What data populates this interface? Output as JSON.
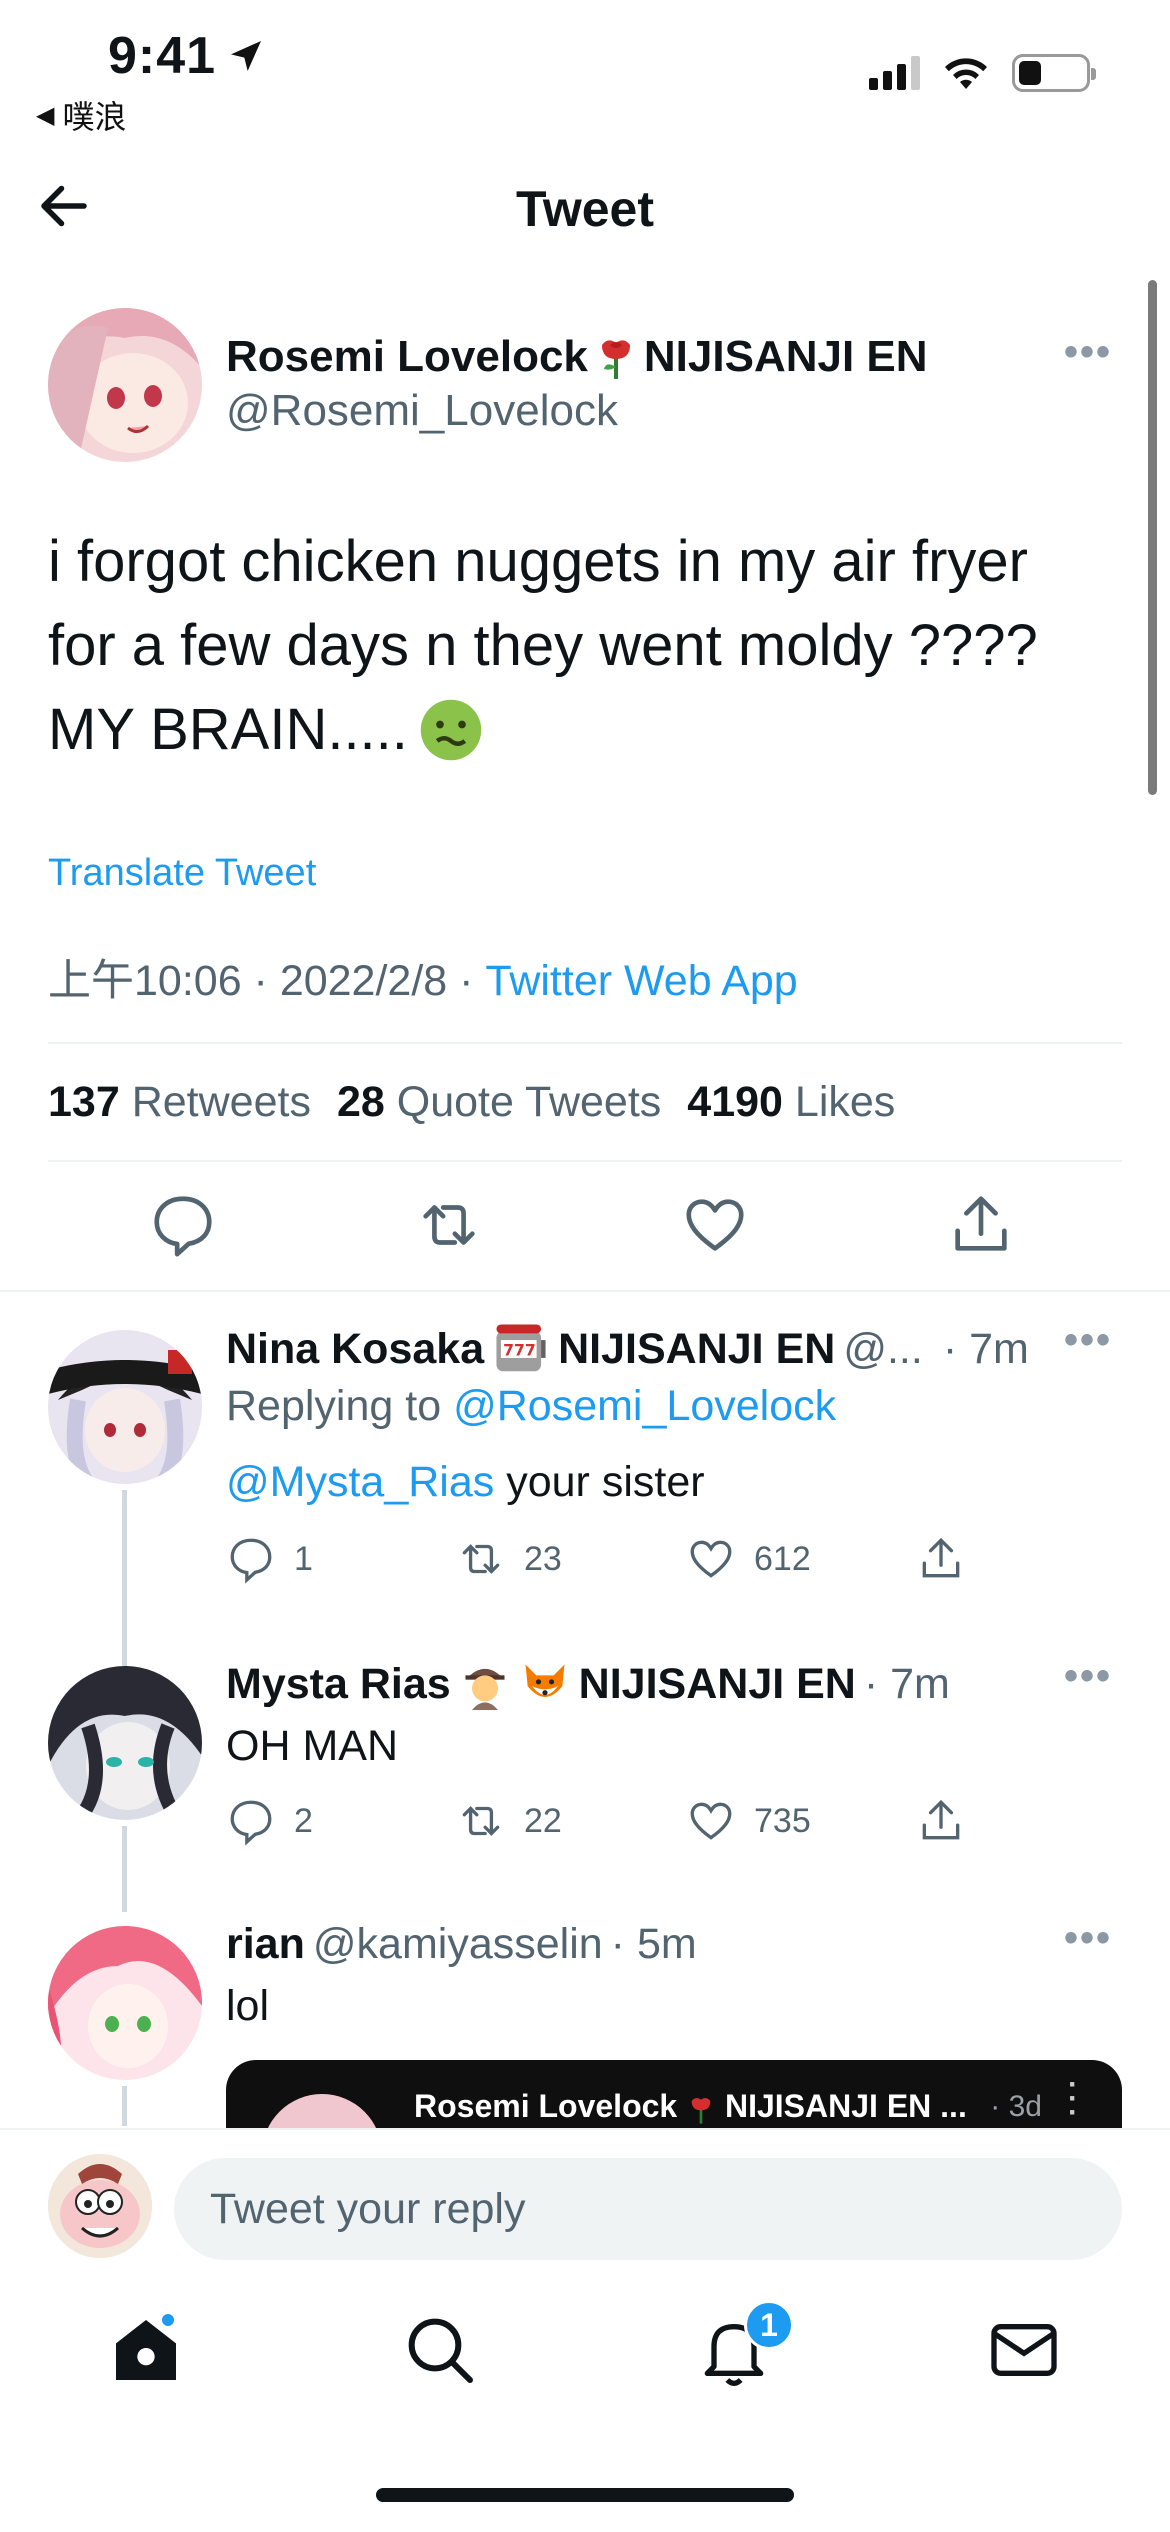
{
  "status_bar": {
    "time": "9:41",
    "back_app": "噗浪"
  },
  "header": {
    "title": "Tweet"
  },
  "main_tweet": {
    "name": "Rosemi Lovelock",
    "name_suffix": "NIJISANJI EN",
    "handle": "@Rosemi_Lovelock",
    "text_line1": "i forgot chicken nuggets in my air fryer",
    "text_line2": "for a few days n they went moldy ????",
    "text_line3": "MY BRAIN.....",
    "translate": "Translate Tweet",
    "time": "上午10:06 · 2022/2/8 · ",
    "app": "Twitter Web App",
    "retweets_count": "137",
    "retweets_label": "Retweets",
    "quotes_count": "28",
    "quotes_label": "Quote Tweets",
    "likes_count": "4190",
    "likes_label": "Likes"
  },
  "replies": [
    {
      "name": "Nina Kosaka",
      "name_suffix": "NIJISANJI EN",
      "handle": "@...",
      "time": "· 7m",
      "replying_prefix": "Replying to ",
      "replying_to": "@Rosemi_Lovelock",
      "mention": "@Mysta_Rias",
      "text": " your sister",
      "replies": "1",
      "retweets": "23",
      "likes": "612"
    },
    {
      "name": "Mysta Rias",
      "name_suffix": "NIJISANJI EN",
      "time": "· 7m",
      "text": "OH MAN",
      "replies": "2",
      "retweets": "22",
      "likes": "735"
    },
    {
      "name": "rian",
      "handle": "@kamiyasselin",
      "time": "· 5m",
      "text": "lol",
      "quote_name": "Rosemi Lovelock",
      "quote_suffix": "NIJISANJI EN ...",
      "quote_time": "· 3d"
    }
  ],
  "reply_bar": {
    "placeholder": "Tweet your reply"
  },
  "tabbar": {
    "notifications_badge": "1"
  },
  "colors": {
    "accent": "#1d9bf0",
    "secondary_text": "#536471",
    "primary_text": "#0f1419"
  }
}
